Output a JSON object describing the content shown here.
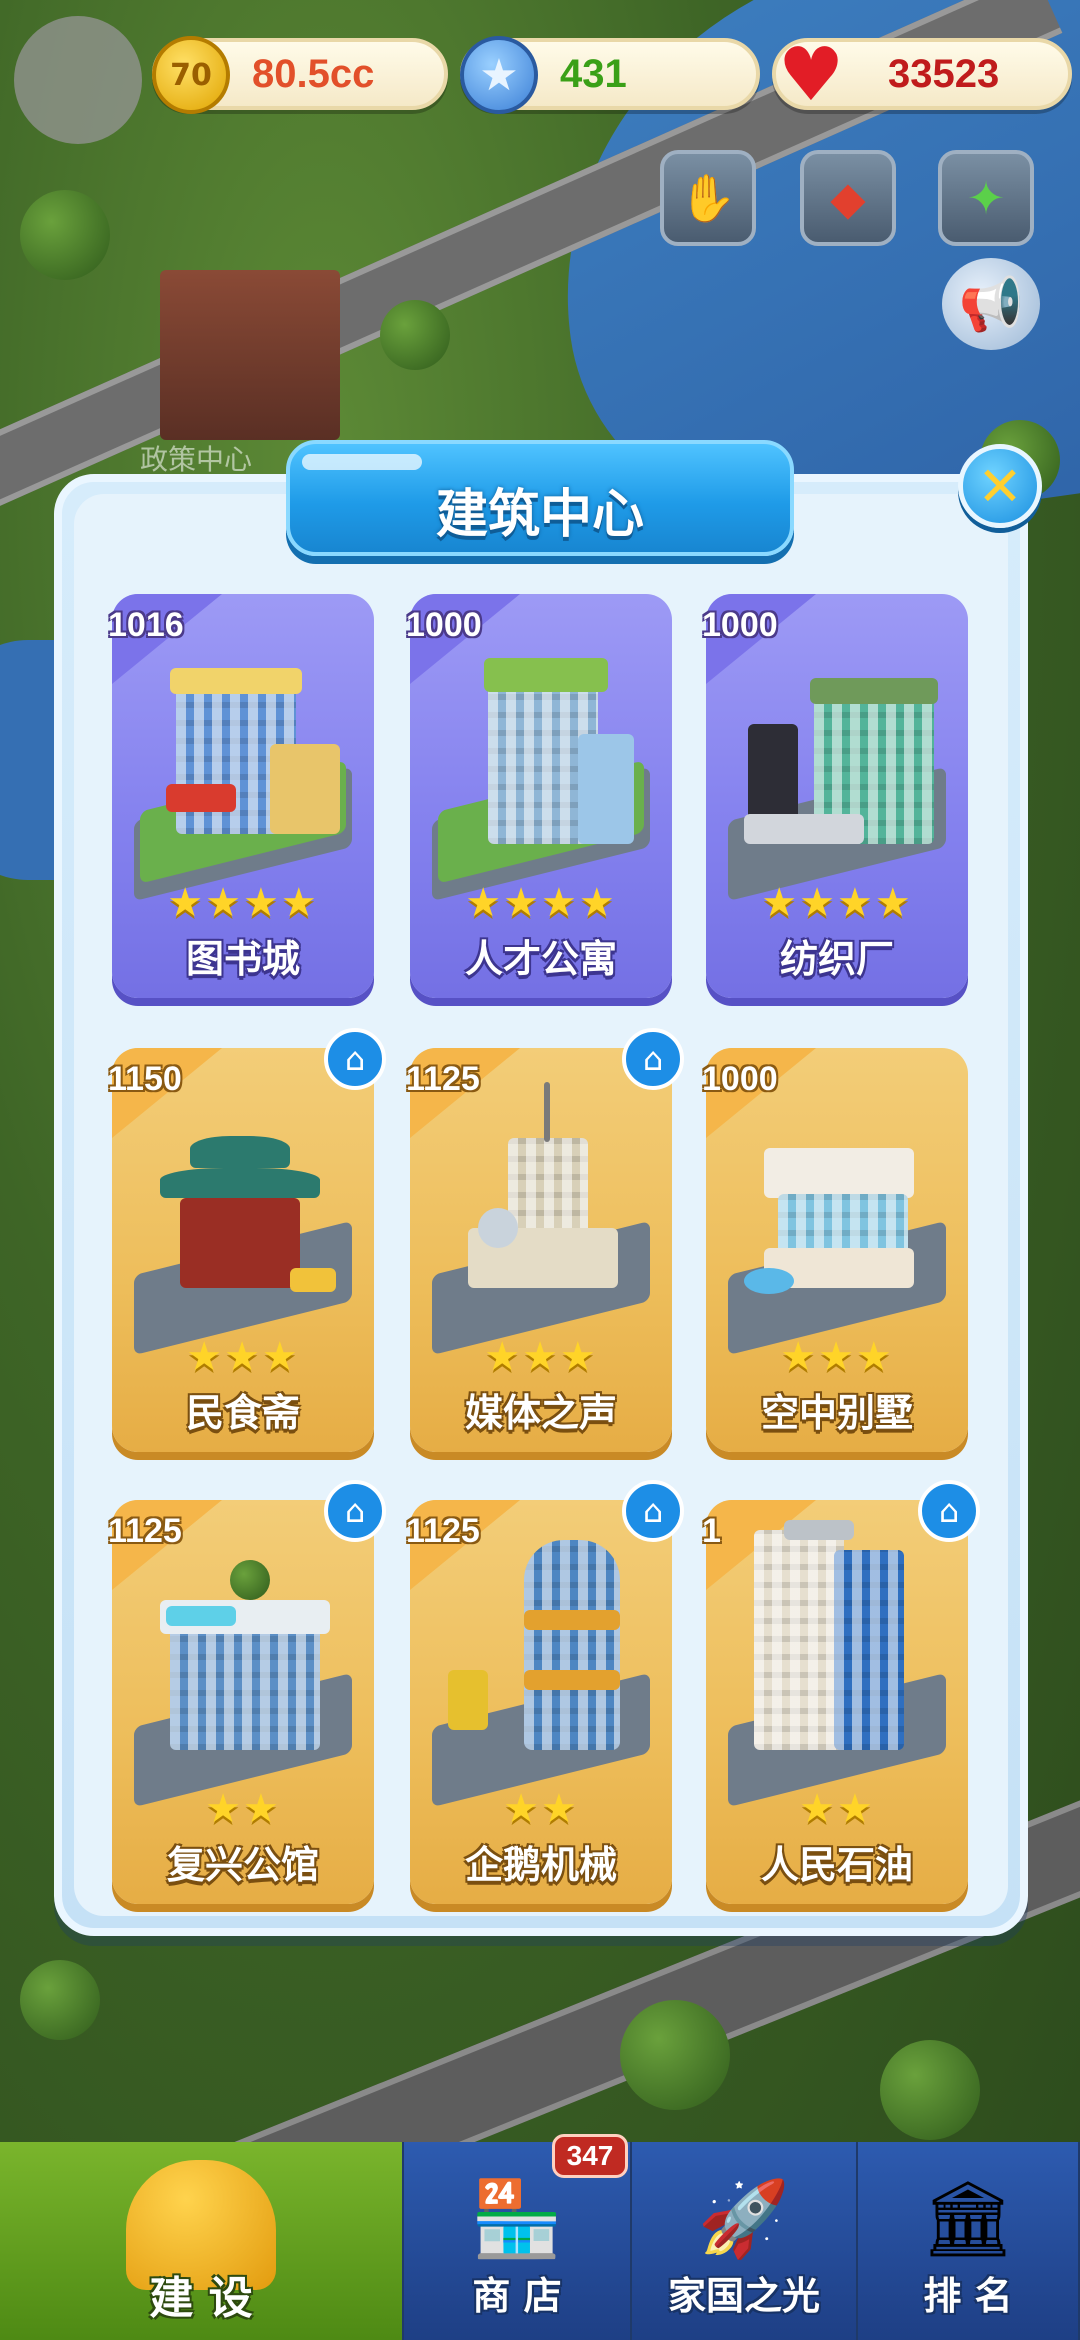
{
  "hud": {
    "coins": "80.5cc",
    "coin_icon_label": "70",
    "stars": "431",
    "hearts": "33523",
    "coin_icon": "coin-icon",
    "star_icon": "blue-star-icon",
    "heart_icon": "heart-icon"
  },
  "world": {
    "building_label": "政策中心"
  },
  "dialog": {
    "title": "建筑中心",
    "close_glyph": "✕"
  },
  "cards": [
    {
      "number": "1016",
      "stars": "★★★★",
      "name": "图书城",
      "style": "purple",
      "home": false
    },
    {
      "number": "1000",
      "stars": "★★★★",
      "name": "人才公寓",
      "style": "purple",
      "home": false
    },
    {
      "number": "1000",
      "stars": "★★★★",
      "name": "纺织厂",
      "style": "purple",
      "home": false
    },
    {
      "number": "1150",
      "stars": "★★★",
      "name": "民食斋",
      "style": "orange",
      "home": true
    },
    {
      "number": "1125",
      "stars": "★★★",
      "name": "媒体之声",
      "style": "orange",
      "home": true
    },
    {
      "number": "1000",
      "stars": "★★★",
      "name": "空中别墅",
      "style": "orange",
      "home": false
    },
    {
      "number": "1125",
      "stars": "★★",
      "name": "复兴公馆",
      "style": "orange",
      "home": true
    },
    {
      "number": "1125",
      "stars": "★★",
      "name": "企鹅机械",
      "style": "orange",
      "home": true
    },
    {
      "number": "1",
      "stars": "★★",
      "name": "人民石油",
      "style": "orange",
      "home": true
    }
  ],
  "nav": {
    "build": "建 设",
    "shop": "商 店",
    "shop_badge": "347",
    "home": "家国之光",
    "rank": "排 名"
  },
  "colors": {
    "purple_card": "#8380ee",
    "orange_card": "#edbd5a",
    "title_blue": "#1f9be8",
    "home_badge": "#1d8ee6"
  }
}
